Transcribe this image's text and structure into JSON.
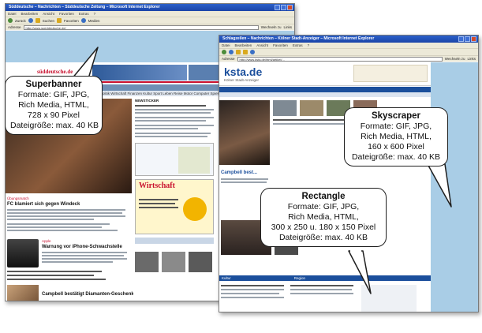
{
  "left_window": {
    "title": "Süddeutsche – Nachrichten – Süddeutsche Zeitung – Microsoft Internet Explorer",
    "menu": [
      "Datei",
      "Bearbeiten",
      "Ansicht",
      "Favoriten",
      "Extras",
      "?"
    ],
    "toolbar": [
      "Zurück",
      "Suchen",
      "Favoriten",
      "Medien"
    ],
    "address_label": "Adresse",
    "address_value": "http://www.sueddeutsche.de/",
    "go_label": "Wechseln zu",
    "links_label": "Links",
    "site": {
      "logo": "süddeutsche.de",
      "nav_items": "Politik  Wirtschaft  Finanzen  Kultur  Sport  Leben  Reise  Motor  Computer  Spiele",
      "headline1": "FC blamiert sich gegen Windeck",
      "section2": "Apple",
      "headline2": "Warnung vor iPhone-Schwachstelle",
      "headline3": "Campbell bestätigt Diamanten-Geschenk",
      "ad_wirtschaft": "Wirtschaft"
    }
  },
  "right_window": {
    "title": "Schlagzeilen – Nachrichten – Kölner Stadt-Anzeiger – Microsoft Internet Explorer",
    "menu": [
      "Datei",
      "Bearbeiten",
      "Ansicht",
      "Favoriten",
      "Extras",
      "?"
    ],
    "address_label": "Adresse",
    "address_value": "http://www.ksta.de/html/artikel/...",
    "go_label": "Wechseln zu",
    "links_label": "Links",
    "site": {
      "logo": "ksta.de",
      "logo_sub": "Kölner Stadt-Anzeiger",
      "headline1": "Campbell best...",
      "sections": [
        "Kultur",
        "Region"
      ]
    }
  },
  "callouts": {
    "superbanner": {
      "title": "Superbanner",
      "lines": [
        "Formate: GIF, JPG,",
        "Rich Media, HTML,",
        "728 x 90 Pixel",
        "Dateigröße: max. 40 KB"
      ]
    },
    "skyscraper": {
      "title": "Skyscraper",
      "lines": [
        "Formate: GIF, JPG,",
        "Rich Media, HTML,",
        "160 x 600 Pixel",
        "Dateigröße: max. 40 KB"
      ]
    },
    "rectangle": {
      "title": "Rectangle",
      "lines": [
        "Formate: GIF, JPG,",
        "Rich Media, HTML,",
        "300 x 250 u. 180 x 150 Pixel",
        "Dateigröße: max. 40 KB"
      ]
    }
  },
  "colors": {
    "ad_placeholder": "#a9cde6",
    "titlebar": "#1f4fb8",
    "brand_red": "#c8102e"
  }
}
